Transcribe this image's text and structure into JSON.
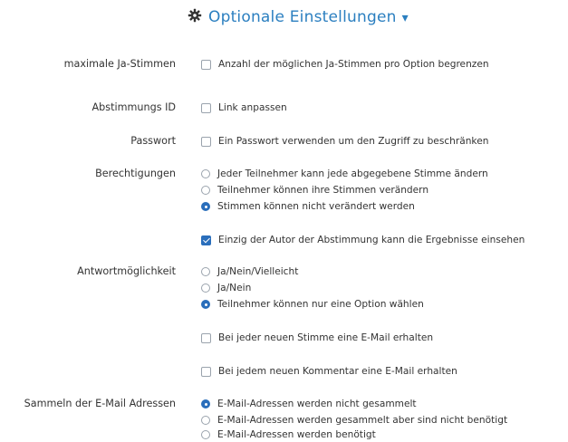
{
  "header": {
    "title": "Optionale Einstellungen",
    "caret": "▾",
    "icon": "gear-icon"
  },
  "colors": {
    "accent": "#2b7fc0",
    "checked": "#2a6ebb"
  },
  "max_votes": {
    "label": "maximale Ja-Stimmen",
    "option": "Anzahl der möglichen Ja-Stimmen pro Option begrenzen",
    "checked": false
  },
  "poll_id": {
    "label": "Abstimmungs ID",
    "option": "Link anpassen",
    "checked": false
  },
  "password": {
    "label": "Passwort",
    "option": "Ein Passwort verwenden um den Zugriff zu beschränken",
    "checked": false
  },
  "permissions": {
    "label": "Berechtigungen",
    "options": [
      {
        "text": "Jeder Teilnehmer kann jede abgegebene Stimme ändern",
        "checked": false
      },
      {
        "text": "Teilnehmer können ihre Stimmen verändern",
        "checked": false
      },
      {
        "text": "Stimmen können nicht verändert werden",
        "checked": true
      }
    ],
    "author_only_results": {
      "text": "Einzig der Autor der Abstimmung kann die Ergebnisse einsehen",
      "checked": true
    }
  },
  "answers": {
    "label": "Antwortmöglichkeit",
    "options": [
      {
        "text": "Ja/Nein/Vielleicht",
        "checked": false
      },
      {
        "text": "Ja/Nein",
        "checked": false
      },
      {
        "text": "Teilnehmer können nur eine Option wählen",
        "checked": true
      }
    ]
  },
  "email_vote": {
    "text": "Bei jeder neuen Stimme eine E-Mail erhalten",
    "checked": false
  },
  "email_comment": {
    "text": "Bei jedem neuen Kommentar eine E-Mail erhalten",
    "checked": false
  },
  "collect_emails": {
    "label": "Sammeln der E-Mail Adressen",
    "options": [
      {
        "text": "E-Mail-Adressen werden nicht gesammelt",
        "checked": true
      },
      {
        "text": "E-Mail-Adressen werden gesammelt aber sind nicht benötigt",
        "checked": false
      },
      {
        "text": "E-Mail-Adressen werden benötigt",
        "checked": false
      }
    ]
  }
}
